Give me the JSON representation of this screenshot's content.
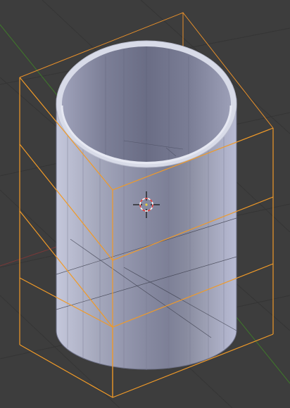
{
  "viewport": {
    "background": "#3d3d3d",
    "grid_color": "#353535",
    "x_axis_color": "#8a3d3d",
    "y_axis_color": "#3f7a2a"
  },
  "object": {
    "type": "hollow cylinder",
    "body_color": "#8d90a8",
    "rim_color": "#e2e4f0",
    "selection_color": "#f09a28"
  },
  "cursor": {
    "icon": "3d-cursor-icon"
  }
}
